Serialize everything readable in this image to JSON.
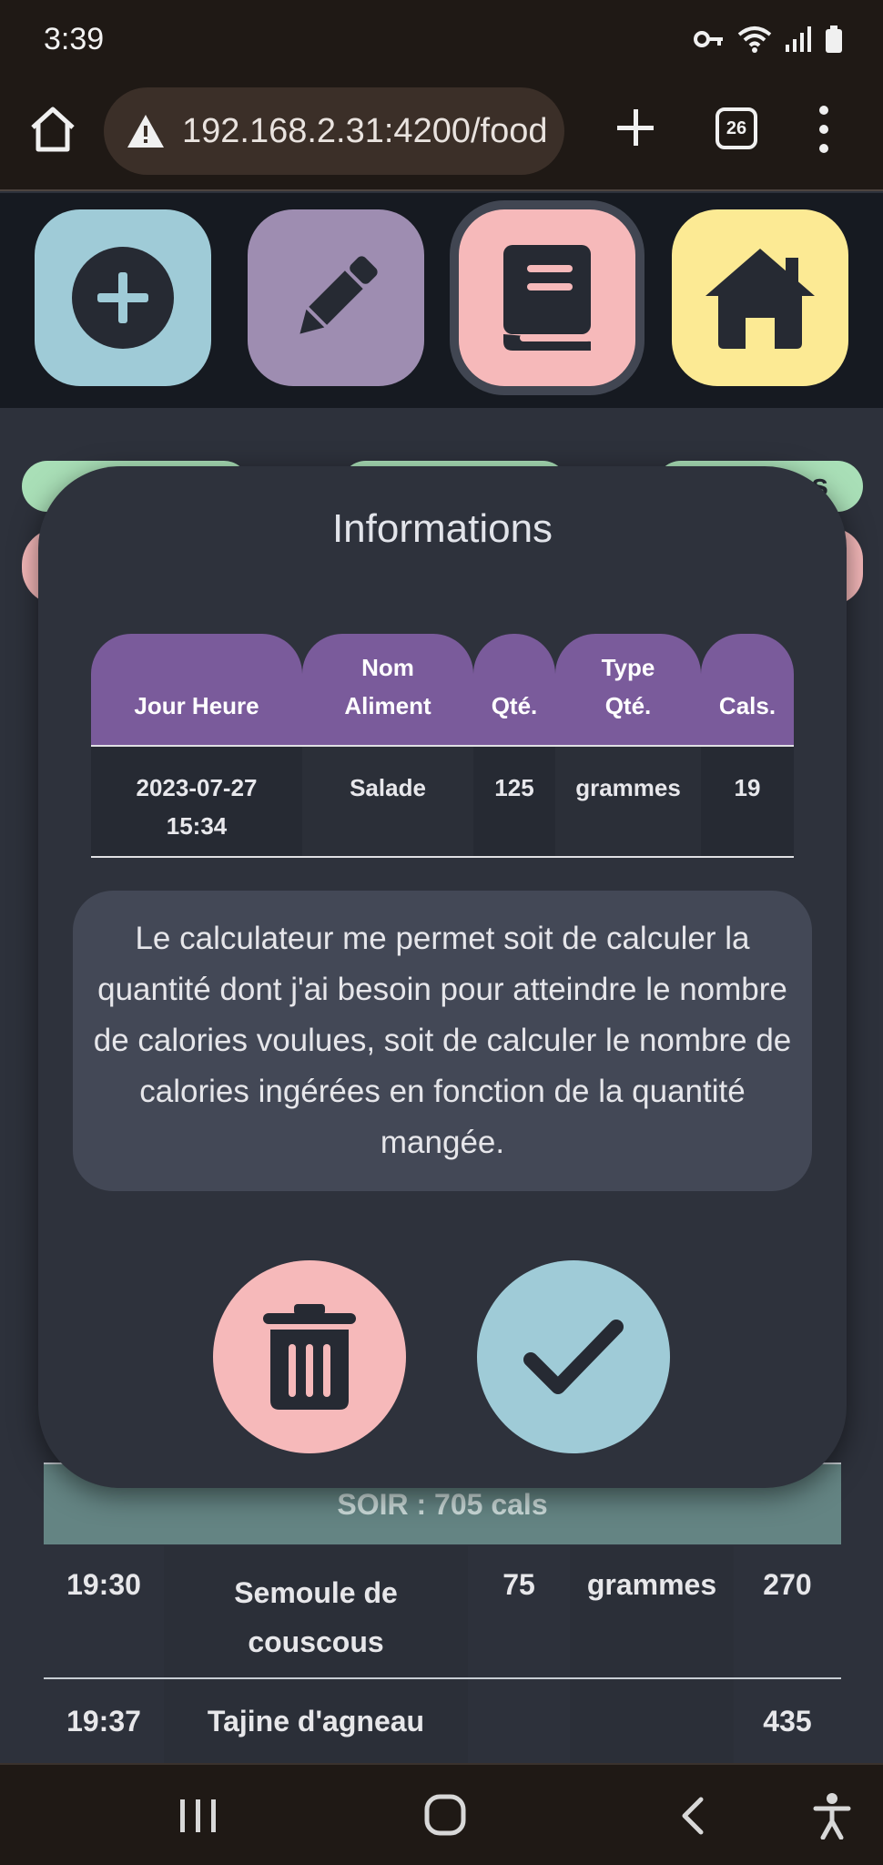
{
  "status_bar": {
    "time": "3:39"
  },
  "browser": {
    "url": "192.168.2.31:4200/food",
    "tab_count": "26"
  },
  "nav": {
    "add": "plus-circle-icon",
    "edit": "pencil-icon",
    "book": "book-icon",
    "home": "house-icon"
  },
  "colors": {
    "add": "#9fcbd7",
    "edit": "#9e8db1",
    "book": "#f6b9ba",
    "home": "#fcea94",
    "table_header": "#7a5b9b",
    "modal_bg": "#2e323c"
  },
  "modal": {
    "title": "Informations",
    "columns": [
      {
        "line1": "",
        "line2": "Jour Heure"
      },
      {
        "line1": "Nom",
        "line2": "Aliment"
      },
      {
        "line1": "",
        "line2": "Qté."
      },
      {
        "line1": "Type",
        "line2": "Qté."
      },
      {
        "line1": "",
        "line2": "Cals."
      }
    ],
    "row": {
      "date": "2023-07-27",
      "time": "15:34",
      "food": "Salade",
      "qty": "125",
      "qty_type": "grammes",
      "cals": "19"
    },
    "description": "Le calculateur me permet soit de calculer la quantité dont j'ai besoin pour atteindre le nombre de calories voulues, soit de calculer le nombre de calories ingérées en fonction de la quantité mangée."
  },
  "background": {
    "pill_fragment": "es",
    "soir_header": "SOIR : 705 cals",
    "rows": [
      {
        "time": "19:30",
        "food_line1": "Semoule de",
        "food_line2": "couscous",
        "qty": "75",
        "qty_type": "grammes",
        "cals": "270"
      },
      {
        "time": "19:37",
        "food_line1": "Tajine d'agneau",
        "food_line2": "",
        "qty": "",
        "qty_type": "",
        "cals": "435"
      }
    ]
  }
}
